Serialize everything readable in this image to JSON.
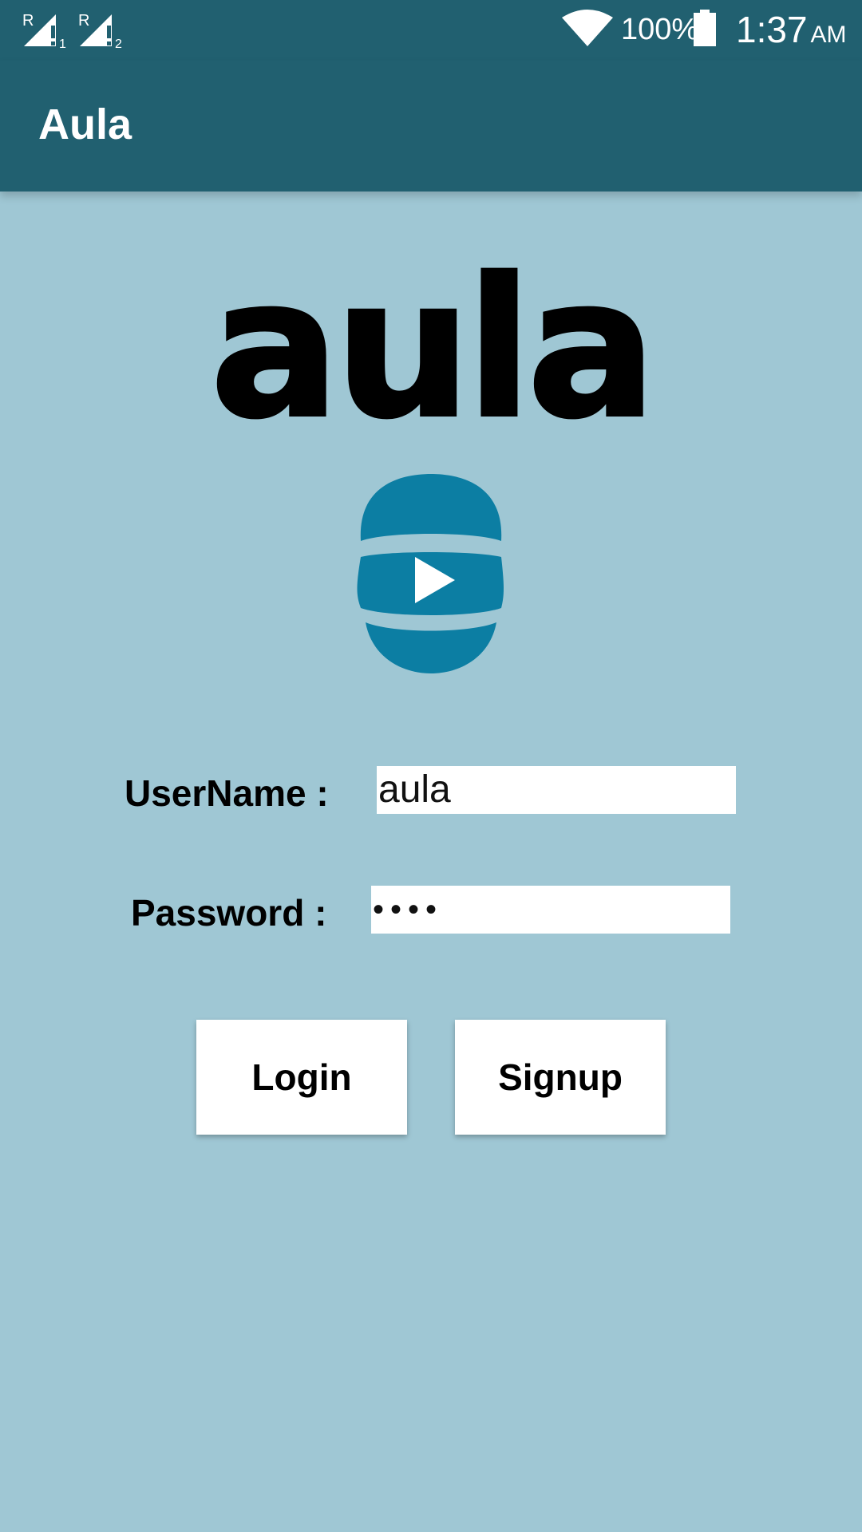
{
  "status_bar": {
    "sim1_label": "R",
    "sim1_index": "1",
    "sim2_label": "R",
    "sim2_index": "2",
    "battery_percent": "100%",
    "time": "1:37",
    "ampm": "AM",
    "icons": [
      "signal-sim1-icon",
      "signal-sim2-icon",
      "wifi-icon",
      "battery-icon"
    ]
  },
  "app_bar": {
    "title": "Aula"
  },
  "logo": {
    "wordmark": "aula",
    "icon": "play-logo-icon",
    "accent_color": "#0c7ea3"
  },
  "form": {
    "username_label": "UserName :",
    "username_value": "aula",
    "password_label": "Password :",
    "password_value": "aula"
  },
  "buttons": {
    "login_label": "Login",
    "signup_label": "Signup"
  },
  "colors": {
    "status_bar": "#216070",
    "app_bar": "#216070",
    "background": "#9fc7d4",
    "button_bg": "#ffffff"
  }
}
